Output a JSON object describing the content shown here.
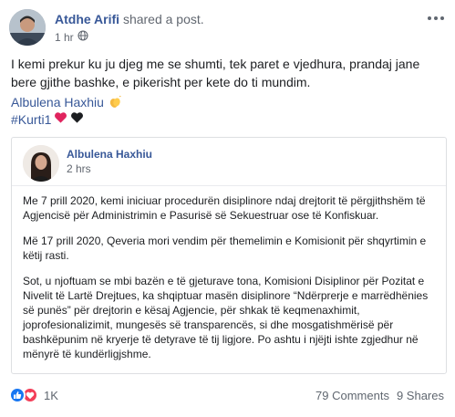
{
  "post": {
    "author": "Atdhe Arifi",
    "action": "shared a post.",
    "time": "1 hr",
    "text": "I kemi prekur ku ju djeg me se shumti, tek paret e vjedhura, prandaj jane bere gjithe bashke, e pikerisht per kete do ti mundim.",
    "mention": "Albulena Haxhiu",
    "hashtag": "#Kurti1",
    "icons": {
      "privacy": "globe-icon",
      "more": "more-options-icon"
    }
  },
  "shared": {
    "author": "Albulena Haxhiu",
    "time": "2 hrs",
    "paragraphs": [
      "Me 7 prill 2020, kemi iniciuar procedurën disiplinore ndaj drejtorit të përgjithshëm të Agjencisë për Administrimin e Pasurisë së Sekuestruar ose të Konfiskuar.",
      "Më 17 prill 2020, Qeveria mori vendim për themelimin e Komisionit për shqyrtimin e këtij rasti.",
      "Sot, u njoftuam se mbi bazën e të gjeturave tona, Komisioni Disiplinor për Pozitat e Nivelit të Lartë Drejtues, ka shqiptuar masën disiplinore “Ndërprerje e marrëdhënies së punës” për drejtorin e kësaj Agjencie, për shkak të keqmenaxhimit, joprofesionalizimit, mungesës së transparencës, si dhe mosgatishmërisë për bashkëpunim në kryerje të detyrave të tij ligjore. Po ashtu i njëjti ishte zgjedhur në mënyrë të kundërligjshme."
    ]
  },
  "footer": {
    "reaction_count": "1K",
    "comments": "79 Comments",
    "shares": "9 Shares"
  },
  "colors": {
    "link": "#385898",
    "meta": "#616770",
    "like": "#1877f2",
    "love": "#f33e58",
    "heart_red": "#e0245e",
    "heart_black": "#1c1e21"
  }
}
